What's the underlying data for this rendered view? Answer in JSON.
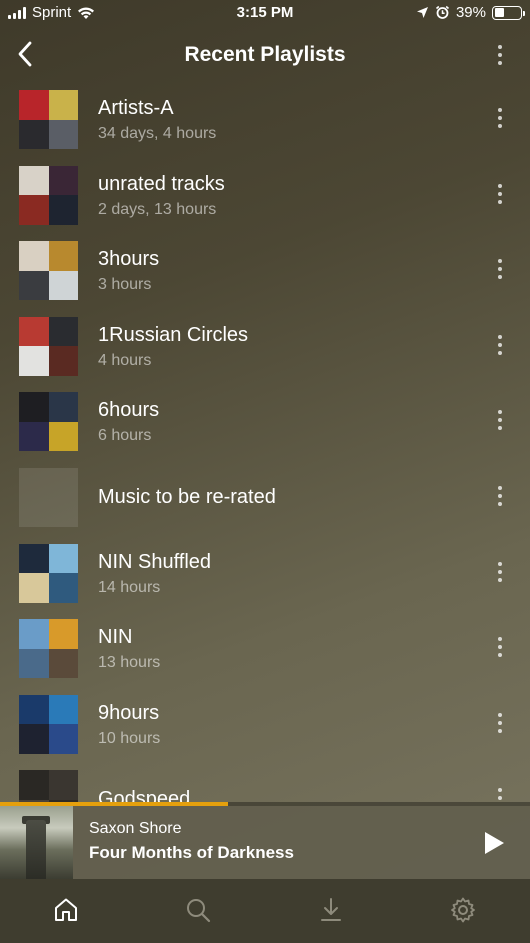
{
  "status_bar": {
    "carrier": "Sprint",
    "time": "3:15 PM",
    "battery": "39%",
    "battery_level": 0.39
  },
  "header": {
    "title": "Recent Playlists",
    "back_icon": "chevron-left-icon",
    "more_icon": "more-vertical-icon"
  },
  "playlists": [
    {
      "title": "Artists-A",
      "subtitle": "34 days, 4 hours",
      "art": [
        "#b8252a",
        "#c9b24a",
        "#2a2a2e",
        "#5a5e66"
      ]
    },
    {
      "title": "unrated tracks",
      "subtitle": "2 days, 13 hours",
      "art": [
        "#d8d2c8",
        "#3a2636",
        "#8a2a22",
        "#1e2430"
      ]
    },
    {
      "title": "3hours",
      "subtitle": "3 hours",
      "art": [
        "#d9d0c2",
        "#b8892e",
        "#3a3c40",
        "#cfd4d6"
      ]
    },
    {
      "title": "1Russian Circles",
      "subtitle": "4 hours",
      "art": [
        "#b83a32",
        "#2a2c30",
        "#e2e2e0",
        "#5a2a22"
      ]
    },
    {
      "title": "6hours",
      "subtitle": "6 hours",
      "art": [
        "#1e1e22",
        "#2a3648",
        "#2c2a4a",
        "#c7a428"
      ]
    },
    {
      "title": "Music to be re-rated",
      "subtitle": "",
      "art": []
    },
    {
      "title": "NIN Shuffled",
      "subtitle": "14 hours",
      "art": [
        "#1e2a3c",
        "#7fb6d8",
        "#d8c89a",
        "#2f5a7e"
      ]
    },
    {
      "title": "NIN",
      "subtitle": "13 hours",
      "art": [
        "#6a9cc8",
        "#d89a2a",
        "#4a6a8a",
        "#5a4a3a"
      ]
    },
    {
      "title": "9hours",
      "subtitle": "10 hours",
      "art": [
        "#1a3a6a",
        "#2a7ab8",
        "#1e2230",
        "#2a4a8a"
      ]
    },
    {
      "title": "Godspeed",
      "subtitle": "",
      "art": [
        "#2a2824",
        "#3a3630",
        "#4a4238",
        "#2e2a24"
      ]
    }
  ],
  "player": {
    "artist": "Saxon Shore",
    "track": "Four Months of Darkness",
    "progress": 0.43,
    "play_icon": "play-icon"
  },
  "tabs": [
    {
      "name": "home",
      "icon": "home-icon",
      "active": true
    },
    {
      "name": "search",
      "icon": "search-icon",
      "active": false
    },
    {
      "name": "downloads",
      "icon": "download-icon",
      "active": false
    },
    {
      "name": "settings",
      "icon": "gear-icon",
      "active": false
    }
  ],
  "colors": {
    "accent": "#e5a00d",
    "text": "#ffffff",
    "subtext": "#a9a594"
  }
}
